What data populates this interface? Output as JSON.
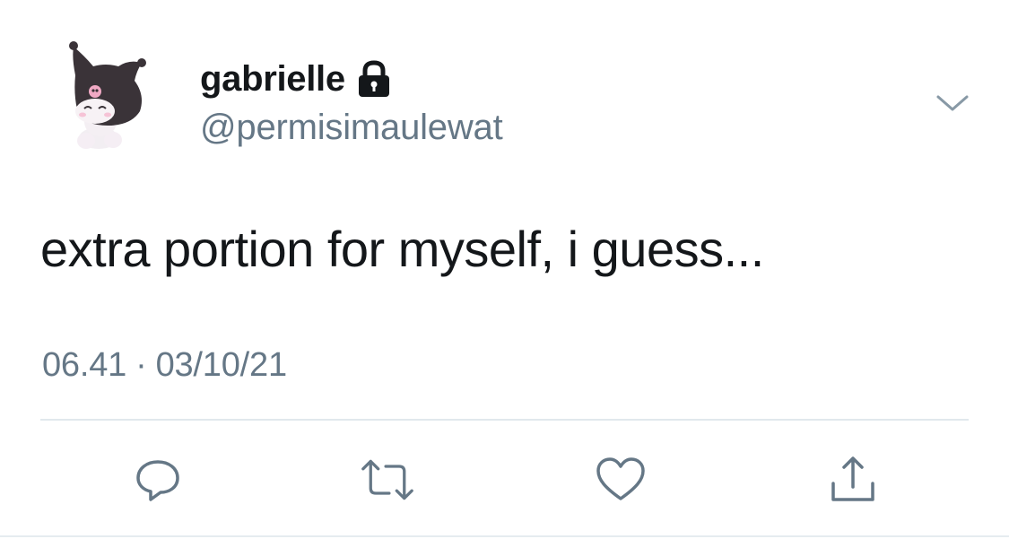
{
  "tweet": {
    "display_name": "gabrielle",
    "handle": "@permisimaulewat",
    "text": "extra portion for myself, i guess...",
    "time": "06.41",
    "separator": "·",
    "date": "03/10/21"
  },
  "icons": {
    "avatar": "kuromi-avatar",
    "lock": "lock-icon",
    "menu": "chevron-down-icon",
    "reply": "reply-icon",
    "retweet": "retweet-icon",
    "like": "heart-icon",
    "share": "share-icon"
  },
  "colors": {
    "text_primary": "#14171a",
    "text_secondary": "#657786",
    "divider": "#e1e8ed",
    "background": "#ffffff"
  }
}
